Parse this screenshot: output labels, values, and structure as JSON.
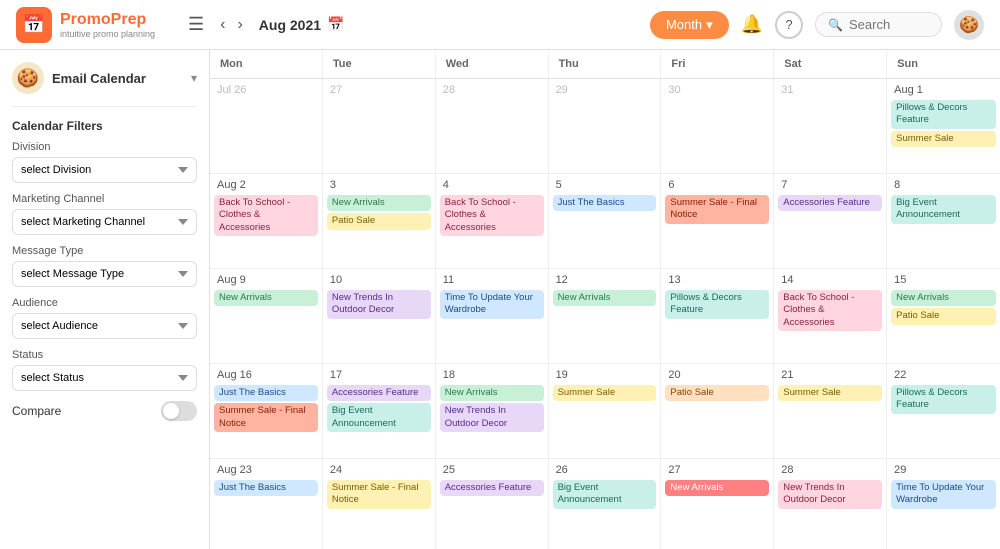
{
  "header": {
    "logo_name": "PromoPrep",
    "logo_tagline": "intuitive promo planning",
    "logo_emoji": "📅",
    "nav_back": "‹",
    "nav_forward": "›",
    "current_month": "Aug 2021",
    "month_btn_label": "Month",
    "bell_label": "🔔",
    "help_label": "?",
    "search_placeholder": "Search",
    "user_emoji": "🍪"
  },
  "sidebar": {
    "title": "Email Calendar",
    "avatar_emoji": "🍪",
    "filters_label": "Calendar Filters",
    "division_label": "Division",
    "division_placeholder": "select Division",
    "marketing_channel_label": "Marketing Channel",
    "marketing_channel_placeholder": "select Marketing Channel",
    "message_type_label": "Message Type",
    "message_type_placeholder": "select Message Type",
    "audience_label": "Audience",
    "audience_placeholder": "select Audience",
    "status_label": "Status",
    "status_placeholder": "select Status",
    "compare_label": "Compare"
  },
  "calendar": {
    "day_headers": [
      "Mon",
      "Tue",
      "Wed",
      "Thu",
      "Fri",
      "Sat",
      "Sun"
    ],
    "weeks": [
      {
        "cells": [
          {
            "date": "Jul 26",
            "prev": true,
            "events": []
          },
          {
            "date": "27",
            "prev": true,
            "events": []
          },
          {
            "date": "28",
            "prev": true,
            "events": []
          },
          {
            "date": "29",
            "prev": true,
            "events": []
          },
          {
            "date": "30",
            "prev": true,
            "events": []
          },
          {
            "date": "31",
            "prev": true,
            "events": []
          },
          {
            "date": "Aug 1",
            "events": [
              {
                "label": "Pillows & Decors Feature",
                "color": "teal"
              },
              {
                "label": "Summer Sale",
                "color": "yellow"
              }
            ]
          }
        ]
      },
      {
        "cells": [
          {
            "date": "Aug 2",
            "events": [
              {
                "label": "Back To School - Clothes & Accessories",
                "color": "pink"
              }
            ]
          },
          {
            "date": "3",
            "events": [
              {
                "label": "New Arrivals",
                "color": "green"
              },
              {
                "label": "Patio Sale",
                "color": "yellow"
              }
            ]
          },
          {
            "date": "4",
            "events": [
              {
                "label": "Back To School - Clothes & Accessories",
                "color": "pink"
              }
            ]
          },
          {
            "date": "5",
            "events": [
              {
                "label": "Just The Basics",
                "color": "blue"
              }
            ]
          },
          {
            "date": "6",
            "events": [
              {
                "label": "Summer Sale - Final Notice",
                "color": "coral"
              }
            ]
          },
          {
            "date": "7",
            "events": [
              {
                "label": "Accessories Feature",
                "color": "purple"
              }
            ]
          },
          {
            "date": "8",
            "events": [
              {
                "label": "Big Event Announcement",
                "color": "teal"
              }
            ]
          }
        ]
      },
      {
        "cells": [
          {
            "date": "Aug 9",
            "events": [
              {
                "label": "New Arrivals",
                "color": "green"
              }
            ]
          },
          {
            "date": "10",
            "events": [
              {
                "label": "New Trends In Outdoor Decor",
                "color": "purple"
              }
            ]
          },
          {
            "date": "11",
            "events": [
              {
                "label": "Time To Update Your Wardrobe",
                "color": "blue"
              }
            ]
          },
          {
            "date": "12",
            "events": [
              {
                "label": "New Arrivals",
                "color": "green"
              }
            ]
          },
          {
            "date": "13",
            "events": [
              {
                "label": "Pillows & Decors Feature",
                "color": "teal"
              }
            ]
          },
          {
            "date": "14",
            "events": [
              {
                "label": "Back To School - Clothes & Accessories",
                "color": "pink"
              }
            ]
          },
          {
            "date": "15",
            "events": [
              {
                "label": "New Arrivals",
                "color": "green"
              },
              {
                "label": "Patio Sale",
                "color": "yellow"
              }
            ]
          }
        ]
      },
      {
        "cells": [
          {
            "date": "Aug 16",
            "events": [
              {
                "label": "Just The Basics",
                "color": "blue"
              },
              {
                "label": "Summer Sale - Final Notice",
                "color": "coral"
              }
            ]
          },
          {
            "date": "17",
            "events": [
              {
                "label": "Accessories Feature",
                "color": "purple"
              },
              {
                "label": "Big Event Announcement",
                "color": "teal"
              }
            ]
          },
          {
            "date": "18",
            "events": [
              {
                "label": "New Arrivals",
                "color": "green"
              },
              {
                "label": "New Trends In Outdoor Decor",
                "color": "purple"
              }
            ]
          },
          {
            "date": "19",
            "events": [
              {
                "label": "Summer Sale",
                "color": "yellow"
              }
            ]
          },
          {
            "date": "20",
            "events": [
              {
                "label": "Patio Sale",
                "color": "orange"
              }
            ]
          },
          {
            "date": "21",
            "events": [
              {
                "label": "Summer Sale",
                "color": "yellow"
              }
            ]
          },
          {
            "date": "22",
            "events": [
              {
                "label": "Pillows & Decors Feature",
                "color": "teal"
              }
            ]
          }
        ]
      },
      {
        "cells": [
          {
            "date": "Aug 23",
            "events": [
              {
                "label": "Just The Basics",
                "color": "blue"
              }
            ]
          },
          {
            "date": "24",
            "events": [
              {
                "label": "Summer Sale - Final Notice",
                "color": "yellow"
              }
            ]
          },
          {
            "date": "25",
            "events": [
              {
                "label": "Accessories Feature",
                "color": "purple"
              }
            ]
          },
          {
            "date": "26",
            "events": [
              {
                "label": "Big Event Announcement",
                "color": "teal"
              }
            ]
          },
          {
            "date": "27",
            "events": [
              {
                "label": "New Arrivals",
                "color": "red"
              }
            ]
          },
          {
            "date": "28",
            "events": [
              {
                "label": "New Trends In Outdoor Decor",
                "color": "pink"
              }
            ]
          },
          {
            "date": "29",
            "events": [
              {
                "label": "Time To Update Your Wardrobe",
                "color": "blue"
              }
            ]
          }
        ]
      }
    ]
  },
  "color_map": {
    "green": "pill-green",
    "yellow": "pill-yellow",
    "pink": "pill-pink",
    "blue": "pill-blue",
    "purple": "pill-purple",
    "teal": "pill-teal",
    "orange": "pill-orange",
    "red": "pill-red",
    "coral": "pill-coral"
  }
}
